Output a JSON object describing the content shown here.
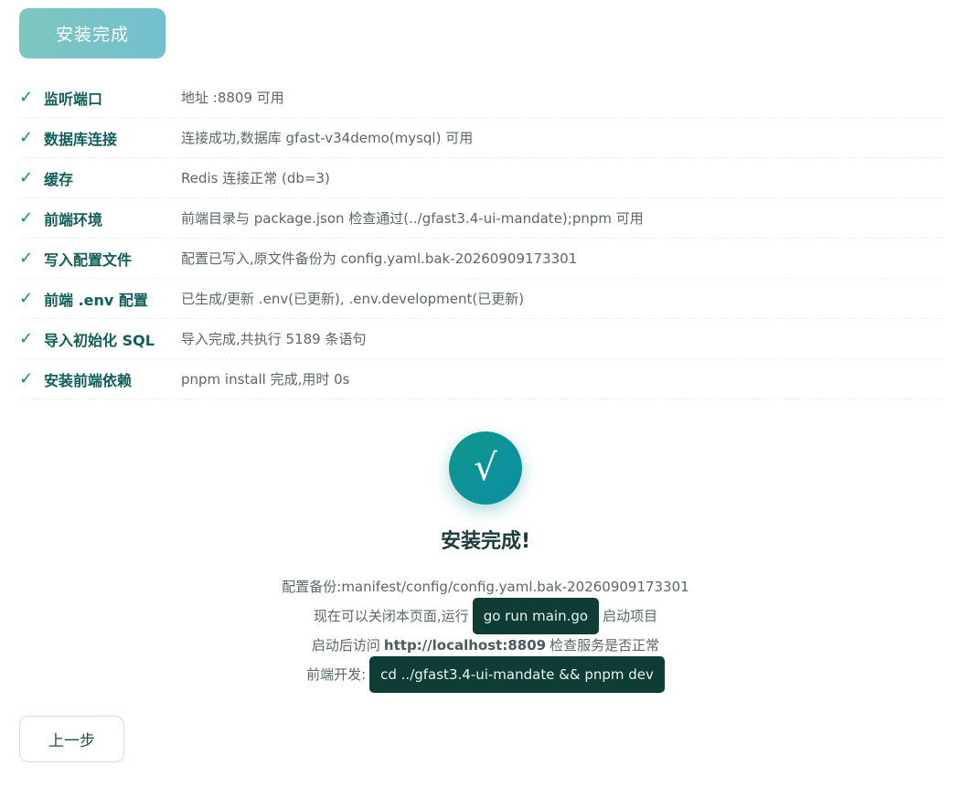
{
  "header": {
    "status_button": "安装完成"
  },
  "checks": [
    {
      "tick": "✓",
      "label": "监听端口",
      "value": "地址 :8809 可用"
    },
    {
      "tick": "✓",
      "label": "数据库连接",
      "value": "连接成功,数据库 gfast-v34demo(mysql) 可用"
    },
    {
      "tick": "✓",
      "label": "缓存",
      "value": "Redis 连接正常 (db=3)"
    },
    {
      "tick": "✓",
      "label": "前端环境",
      "value": "前端目录与 package.json 检查通过(../gfast3.4-ui-mandate);pnpm 可用"
    },
    {
      "tick": "✓",
      "label": "写入配置文件",
      "value": "配置已写入,原文件备份为 config.yaml.bak-20260909173301"
    },
    {
      "tick": "✓",
      "label": "前端 .env 配置",
      "value": "已生成/更新 .env(已更新), .env.development(已更新)"
    },
    {
      "tick": "✓",
      "label": "导入初始化 SQL",
      "value": "导入完成,共执行 5189 条语句"
    },
    {
      "tick": "✓",
      "label": "安装前端依赖",
      "value": "pnpm install 完成,用时 0s"
    }
  ],
  "success": {
    "icon": "√",
    "title": "安装完成!",
    "backup_line": "配置备份:manifest/config/config.yaml.bak-20260909173301",
    "run_prefix": "现在可以关闭本页面,运行",
    "run_command": "go run main.go",
    "run_suffix": "启动项目",
    "visit_prefix": "启动后访问",
    "visit_url": "http://localhost:8809",
    "visit_suffix": "检查服务是否正常",
    "frontend_prefix": "前端开发:",
    "frontend_command": "cd ../gfast3.4-ui-mandate && pnpm dev"
  },
  "footer": {
    "back_button": "上一步"
  },
  "colors": {
    "accent": "#0f8a7d",
    "code_bg": "#0f3d36"
  }
}
